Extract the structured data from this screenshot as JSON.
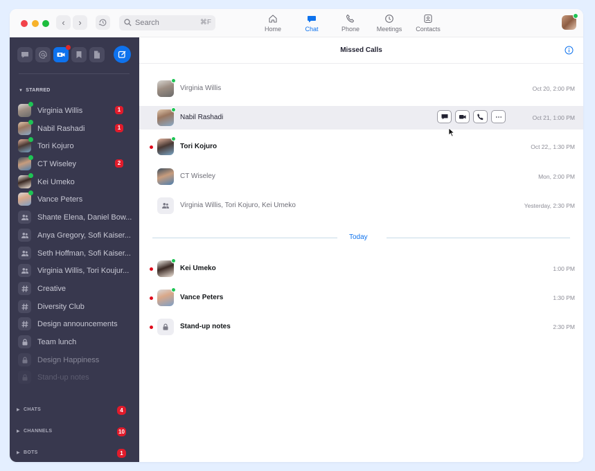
{
  "titlebar": {
    "search": {
      "placeholder": "Search",
      "shortcut": "⌘F"
    },
    "nav": [
      {
        "label": "Home",
        "icon": "home-icon",
        "active": false
      },
      {
        "label": "Chat",
        "icon": "chat-icon",
        "active": true
      },
      {
        "label": "Phone",
        "icon": "phone-icon",
        "active": false
      },
      {
        "label": "Meetings",
        "icon": "clock-icon",
        "active": false
      },
      {
        "label": "Contacts",
        "icon": "contacts-icon",
        "active": false
      }
    ]
  },
  "sidebar": {
    "tools": [
      {
        "icon": "chat-bubble-icon"
      },
      {
        "icon": "mention-icon"
      },
      {
        "icon": "missed-video-icon",
        "active": true,
        "notification": true
      },
      {
        "icon": "bookmark-icon"
      },
      {
        "icon": "file-icon"
      }
    ],
    "starred_label": "STARRED",
    "starred": [
      {
        "name": "Virginia Willis",
        "type": "person",
        "photo": "virginia",
        "online": true,
        "badge": "1"
      },
      {
        "name": "Nabil Rashadi",
        "type": "person",
        "photo": "nabil",
        "online": true,
        "badge": "1"
      },
      {
        "name": "Tori Kojuro",
        "type": "person",
        "photo": "tori",
        "online": true
      },
      {
        "name": "CT Wiseley",
        "type": "person",
        "photo": "ct",
        "online": true,
        "badge": "2"
      },
      {
        "name": "Kei Umeko",
        "type": "person",
        "photo": "kei",
        "online": true
      },
      {
        "name": "Vance Peters",
        "type": "person",
        "photo": "vance",
        "online": true
      },
      {
        "name": "Shante Elena, Daniel Bow...",
        "type": "group"
      },
      {
        "name": "Anya Gregory, Sofi Kaiser...",
        "type": "group"
      },
      {
        "name": "Seth Hoffman, Sofi Kaiser...",
        "type": "group"
      },
      {
        "name": "Virginia Willis, Tori Koujur...",
        "type": "group"
      },
      {
        "name": "Creative",
        "type": "channel"
      },
      {
        "name": "Diversity Club",
        "type": "channel"
      },
      {
        "name": "Design announcements",
        "type": "channel"
      },
      {
        "name": "Team lunch",
        "type": "private"
      },
      {
        "name": "Design Happiness",
        "type": "private",
        "fade": 1
      },
      {
        "name": "Stand-up notes",
        "type": "private",
        "fade": 2
      }
    ],
    "sections": [
      {
        "title": "CHATS",
        "badge": "4"
      },
      {
        "title": "CHANNELS",
        "badge": "10"
      },
      {
        "title": "BOTS",
        "badge": "1"
      }
    ]
  },
  "main": {
    "title": "Missed Calls",
    "today_label": "Today",
    "earlier_calls": [
      {
        "name": "Virginia Willis",
        "time": "Oct 20, 2:00 PM",
        "type": "person",
        "photo": "virginia",
        "online": true,
        "unread": false
      },
      {
        "name": "Nabil Rashadi",
        "time": "Oct 21, 1:00 PM",
        "type": "person",
        "photo": "nabil",
        "online": true,
        "unread": false,
        "hovered": true
      },
      {
        "name": "Tori Kojuro",
        "time": "Oct 22,, 1:30 PM",
        "type": "person",
        "photo": "tori",
        "online": true,
        "unread": true
      },
      {
        "name": "CT Wiseley",
        "time": "Mon, 2:00 PM",
        "type": "person",
        "photo": "ct",
        "online": false,
        "unread": false
      },
      {
        "name": "Virginia Willis, Tori Kojuro, Kei Umeko",
        "time": "Yesterday, 2:30 PM",
        "type": "group",
        "unread": false
      }
    ],
    "today_calls": [
      {
        "name": "Kei Umeko",
        "time": "1:00 PM",
        "type": "person",
        "photo": "kei",
        "online": true,
        "unread": true
      },
      {
        "name": "Vance Peters",
        "time": "1:30 PM",
        "type": "person",
        "photo": "vance",
        "online": true,
        "unread": true
      },
      {
        "name": "Stand-up notes",
        "time": "2:30 PM",
        "type": "private",
        "unread": true
      }
    ],
    "row_actions": [
      {
        "icon": "chat-bubble-icon",
        "label": "Chat"
      },
      {
        "icon": "video-icon",
        "label": "Video"
      },
      {
        "icon": "phone-icon",
        "label": "Phone"
      },
      {
        "icon": "more-icon",
        "label": "More"
      }
    ]
  },
  "colors": {
    "accent": "#0e72ed",
    "sidebar_bg": "#38384e",
    "badge": "#e11b2b",
    "online": "#1ec455",
    "unread_dot": "#e00a1b"
  }
}
